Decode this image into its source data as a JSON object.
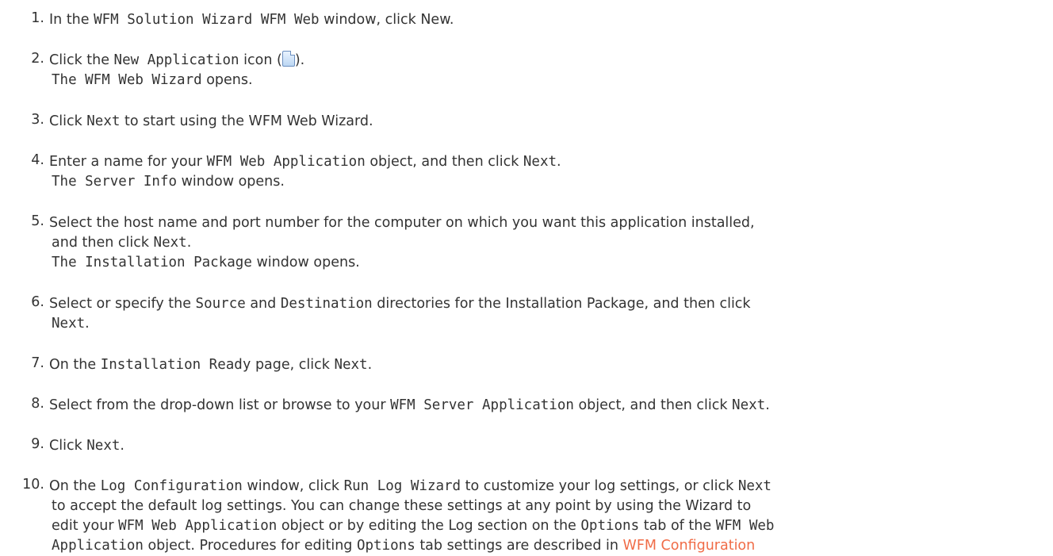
{
  "steps": [
    {
      "num": "1.",
      "parts": [
        {
          "t": "In the "
        },
        {
          "c": "WFM Solution Wizard WFM Web"
        },
        {
          "t": " window, click New."
        }
      ]
    },
    {
      "num": "2.",
      "parts": [
        {
          "t": "Click the "
        },
        {
          "c": "New Application"
        },
        {
          "t": " icon ("
        },
        {
          "icon": "new-document-icon"
        },
        {
          "t": ")."
        }
      ],
      "sub": [
        [
          {
            "c": "The WFM Web Wizard"
          },
          {
            "t": " opens."
          }
        ]
      ]
    },
    {
      "num": "3.",
      "parts": [
        {
          "t": "Click "
        },
        {
          "c": "Next"
        },
        {
          "t": " to start using the WFM Web Wizard."
        }
      ]
    },
    {
      "num": "4.",
      "parts": [
        {
          "t": "Enter a name for your "
        },
        {
          "c": "WFM Web Application"
        },
        {
          "t": " object, and then click "
        },
        {
          "c": "Next"
        },
        {
          "t": "."
        }
      ],
      "sub": [
        [
          {
            "c": "The Server Info"
          },
          {
            "t": " window opens."
          }
        ]
      ]
    },
    {
      "num": "5.",
      "parts": [
        {
          "t": "Select the host name and port number for the computer on which you want this application installed,"
        }
      ],
      "sub": [
        [
          {
            "t": "and then click "
          },
          {
            "c": "Next"
          },
          {
            "t": "."
          }
        ],
        [
          {
            "c": "The Installation Package"
          },
          {
            "t": " window opens."
          }
        ]
      ]
    },
    {
      "num": "6.",
      "parts": [
        {
          "t": "Select or specify the "
        },
        {
          "c": "Source"
        },
        {
          "t": " and "
        },
        {
          "c": "Destination"
        },
        {
          "t": " directories for the Installation Package, and then click"
        }
      ],
      "sub": [
        [
          {
            "c": "Next"
          },
          {
            "t": "."
          }
        ]
      ]
    },
    {
      "num": "7.",
      "parts": [
        {
          "t": "On the "
        },
        {
          "c": "Installation Ready"
        },
        {
          "t": " page, click "
        },
        {
          "c": "Next"
        },
        {
          "t": "."
        }
      ]
    },
    {
      "num": "8.",
      "parts": [
        {
          "t": "Select from the drop-down list or browse to your "
        },
        {
          "c": "WFM Server Application"
        },
        {
          "t": " object, and then click "
        },
        {
          "c": "Next"
        },
        {
          "t": "."
        }
      ]
    },
    {
      "num": "9.",
      "parts": [
        {
          "t": "Click "
        },
        {
          "c": "Next"
        },
        {
          "t": "."
        }
      ]
    },
    {
      "num": "10.",
      "parts": [
        {
          "t": "On the "
        },
        {
          "c": "Log Configuration"
        },
        {
          "t": " window, click "
        },
        {
          "c": "Run Log Wizard"
        },
        {
          "t": " to customize your log settings, or click "
        },
        {
          "c": "Next"
        }
      ],
      "sub": [
        [
          {
            "t": "to accept the default log settings. You can change these settings at any point by using the Wizard to"
          }
        ],
        [
          {
            "t": "edit your "
          },
          {
            "c": "WFM Web Application"
          },
          {
            "t": " object or by editing the Log section on the "
          },
          {
            "c": "Options"
          },
          {
            "t": " tab of the "
          },
          {
            "c": "WFM Web"
          }
        ],
        [
          {
            "c": "Application"
          },
          {
            "t": " object. Procedures for editing "
          },
          {
            "c": "Options"
          },
          {
            "t": " tab settings are described in "
          },
          {
            "link": "WFM Configuration"
          }
        ]
      ]
    }
  ]
}
